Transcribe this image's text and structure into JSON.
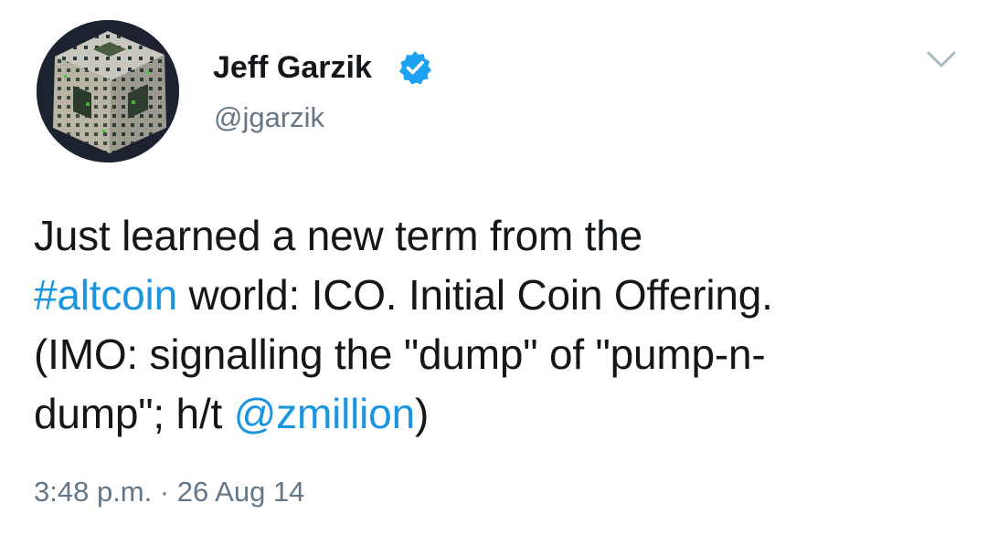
{
  "author": {
    "display_name": "Jeff Garzik",
    "handle": "@jgarzik",
    "verified": true,
    "avatar_icon": "menger-sponge-avatar"
  },
  "menu": {
    "icon": "chevron-down-icon"
  },
  "tweet": {
    "lines": [
      [
        {
          "text": "Just learned a new term from the",
          "type": "text"
        }
      ],
      [
        {
          "text": "#altcoin",
          "type": "hashtag"
        },
        {
          "text": " world: ICO. Initial Coin Offering.",
          "type": "text"
        }
      ],
      [
        {
          "text": "(IMO: signalling the \"dump\" of \"pump-n-",
          "type": "text"
        }
      ],
      [
        {
          "text": "dump\"; h/t ",
          "type": "text"
        },
        {
          "text": "@zmillion",
          "type": "mention"
        },
        {
          "text": ")",
          "type": "text"
        }
      ]
    ]
  },
  "timestamp": "3:48 p.m. · 26 Aug 14",
  "colors": {
    "link": "#1b95e0",
    "verified_badge": "#1da1f2",
    "secondary_text": "#657786",
    "primary_text": "#14171a"
  }
}
